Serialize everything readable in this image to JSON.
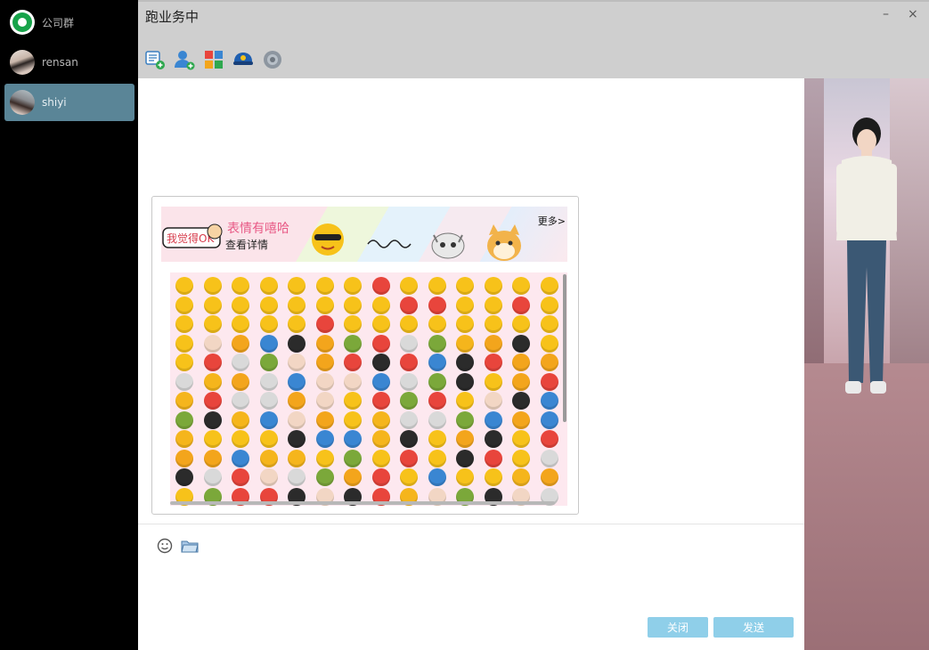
{
  "sidebar": {
    "contacts": [
      {
        "name": "公司群",
        "avatar": "group-icon",
        "active": false
      },
      {
        "name": "rensan",
        "avatar": "user-photo",
        "active": false
      },
      {
        "name": "shiyi",
        "avatar": "user-photo",
        "active": true
      }
    ]
  },
  "window": {
    "title": "跑业务中",
    "minimize_glyph": "–",
    "close_glyph": "×"
  },
  "toolbar": {
    "icons": [
      "new-message-icon",
      "add-contact-icon",
      "apps-icon",
      "police-cap-icon",
      "settings-icon"
    ]
  },
  "emoji_panel": {
    "banner_title": "表情有嘻哈",
    "banner_sub": "查看详情",
    "banner_more": "更多>",
    "banner_ok_text": "我觉得OK",
    "grid_rows": 12,
    "grid_cols": 14
  },
  "input": {
    "emoji_icon": "smiley-icon",
    "folder_icon": "folder-icon"
  },
  "buttons": {
    "close_label": "关闭",
    "send_label": "发送"
  },
  "colors": {
    "sidebar_bg": "#000000",
    "active_contact": "#5a8597",
    "titlebar": "#cfcfcf",
    "button": "#8fcfe9",
    "emoji_bg": "#fde8ef"
  }
}
